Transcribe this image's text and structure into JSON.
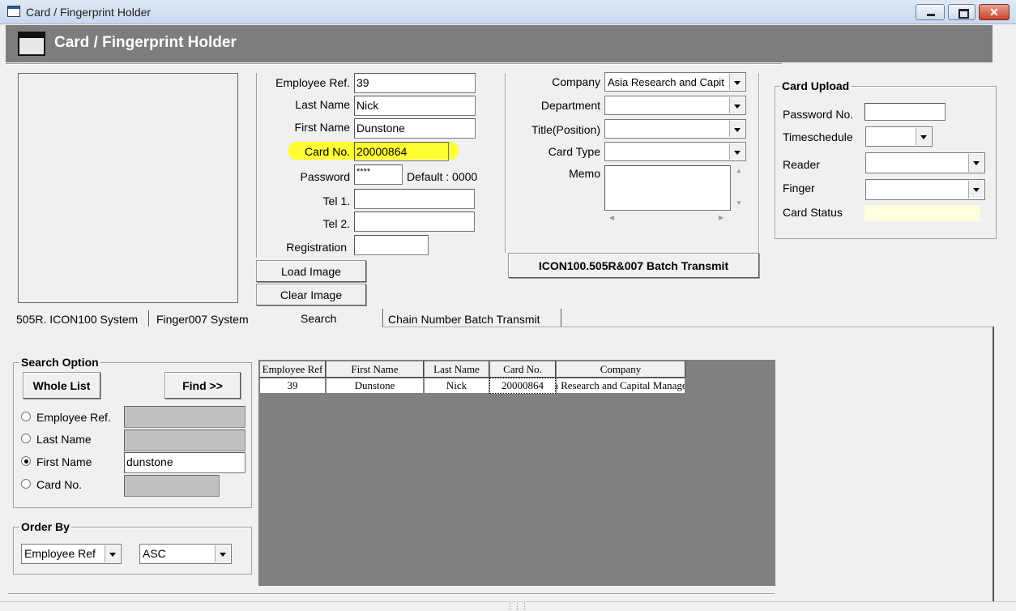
{
  "window": {
    "title": "Card / Fingerprint Holder"
  },
  "header": {
    "title": "Card / Fingerprint Holder"
  },
  "form": {
    "employee_ref_label": "Employee Ref.",
    "employee_ref": "39",
    "last_name_label": "Last Name",
    "last_name": "Nick",
    "first_name_label": "First Name",
    "first_name": "Dunstone",
    "card_no_label": "Card No.",
    "card_no": "20000864",
    "password_label": "Password",
    "password": "****",
    "password_default": "Default : 0000",
    "tel1_label": "Tel 1.",
    "tel1": "",
    "tel2_label": "Tel 2.",
    "tel2": "",
    "registration_label": "Registration",
    "registration": "",
    "load_image": "Load Image",
    "clear_image": "Clear Image"
  },
  "details": {
    "company_label": "Company",
    "company": "Asia Research and Capit",
    "department_label": "Department",
    "department": "",
    "title_label": "Title(Position)",
    "title": "",
    "card_type_label": "Card Type",
    "card_type": "",
    "memo_label": "Memo",
    "memo": "",
    "batch_button": "ICON100.505R&007 Batch Transmit"
  },
  "card_upload": {
    "title": "Card Upload",
    "password_no_label": "Password No.",
    "password_no": "",
    "timeschedule_label": "Timeschedule",
    "timeschedule": "",
    "reader_label": "Reader",
    "reader": "",
    "finger_label": "Finger",
    "finger": "",
    "card_status_label": "Card Status",
    "card_status": ""
  },
  "tabs": [
    {
      "label": "505R. ICON100 System"
    },
    {
      "label": "Finger007 System"
    },
    {
      "label": "Search"
    },
    {
      "label": "Chain Number Batch Transmit"
    }
  ],
  "search": {
    "title": "Search Option",
    "whole_list": "Whole List",
    "find": "Find >>",
    "employee_ref_label": "Employee Ref.",
    "last_name_label": "Last Name",
    "first_name_label": "First Name",
    "first_name_value": "dunstone",
    "card_no_label": "Card No.",
    "selected": "first_name"
  },
  "order_by": {
    "title": "Order By",
    "field": "Employee Ref",
    "direction": "ASC"
  },
  "results": {
    "columns": [
      "Employee Ref",
      "First Name",
      "Last Name",
      "Card No.",
      "Company"
    ],
    "rows": [
      [
        "39",
        "Dunstone",
        "Nick",
        "20000864",
        "Asia Research and Capital Management"
      ]
    ]
  },
  "colors": {
    "header_band": "#7d7d7d",
    "highlight": "#ffff33",
    "grid_bg": "#808080"
  }
}
